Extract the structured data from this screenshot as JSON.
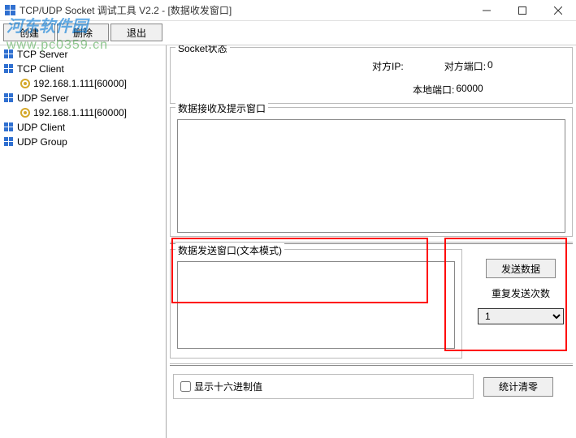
{
  "window": {
    "title": "TCP/UDP Socket 调试工具 V2.2 - [数据收发窗口]"
  },
  "watermark": {
    "logo_text": "河东软件园",
    "url": "www.pc0359.cn"
  },
  "toolbar": {
    "create": "创建",
    "delete": "删除",
    "exit": "退出"
  },
  "sidebar": {
    "items": [
      {
        "label": "TCP Server",
        "type": "server"
      },
      {
        "label": "TCP Client",
        "type": "server"
      },
      {
        "label": "192.168.1.111[60000]",
        "type": "node",
        "child": true
      },
      {
        "label": "UDP Server",
        "type": "server"
      },
      {
        "label": "192.168.1.111[60000]",
        "type": "node",
        "child": true
      },
      {
        "label": "UDP Client",
        "type": "server"
      },
      {
        "label": "UDP Group",
        "type": "server"
      }
    ]
  },
  "socket_status": {
    "title": "Socket状态",
    "remote_ip_label": "对方IP:",
    "remote_port_label": "对方端口:",
    "remote_port_value": "0",
    "local_port_label": "本地端口:",
    "local_port_value": "60000"
  },
  "recv": {
    "title": "数据接收及提示窗口",
    "value": ""
  },
  "send": {
    "title": "数据发送窗口(文本模式)",
    "value": "",
    "button": "发送数据",
    "repeat_label": "重复发送次数",
    "repeat_value": "1"
  },
  "bottom": {
    "hex_checkbox_label": "显示十六进制值",
    "stats_button": "统计清零"
  }
}
